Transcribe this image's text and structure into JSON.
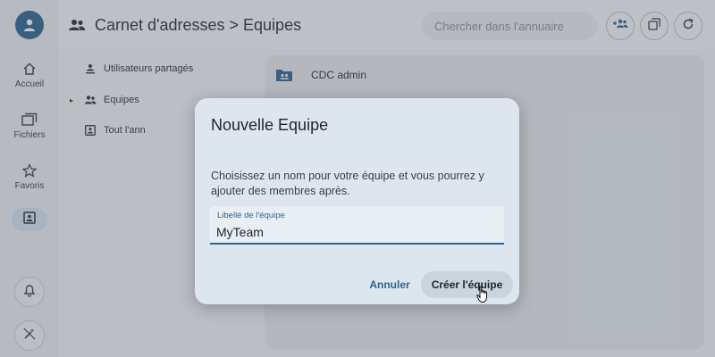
{
  "rail": {
    "items": [
      {
        "label": "Accueil",
        "icon": "home-icon"
      },
      {
        "label": "Fichiers",
        "icon": "files-icon"
      },
      {
        "label": "Favoris",
        "icon": "star-icon"
      }
    ],
    "active_icon": "contacts-icon",
    "bottom_icons": [
      "bell-icon",
      "magic-wand-off-icon"
    ]
  },
  "header": {
    "title": "Carnet d'adresses > Equipes",
    "search_placeholder": "Chercher dans l'annuaire",
    "actions": [
      "add-group-icon",
      "copy-icon",
      "refresh-icon"
    ]
  },
  "nav": {
    "items": [
      {
        "label": "Utilisateurs partagés",
        "icon": "shared-user-icon"
      },
      {
        "label": "Equipes",
        "icon": "group-icon"
      },
      {
        "label": "Tout l'ann",
        "icon": "contact-card-icon"
      }
    ]
  },
  "list": {
    "rows": [
      {
        "label": "CDC admin",
        "icon": "group-folder-icon"
      }
    ]
  },
  "dialog": {
    "title": "Nouvelle Equipe",
    "description": "Choisissez un nom pour votre équipe et vous pourrez y ajouter des membres après.",
    "field_label": "Libellé de l'équipe",
    "field_value": "MyTeam",
    "cancel_label": "Annuler",
    "create_label": "Créer l'équipe"
  },
  "colors": {
    "accent": "#2d6491",
    "dialog_bg": "#dde6ee",
    "rail_active": "#cfe1f2"
  }
}
